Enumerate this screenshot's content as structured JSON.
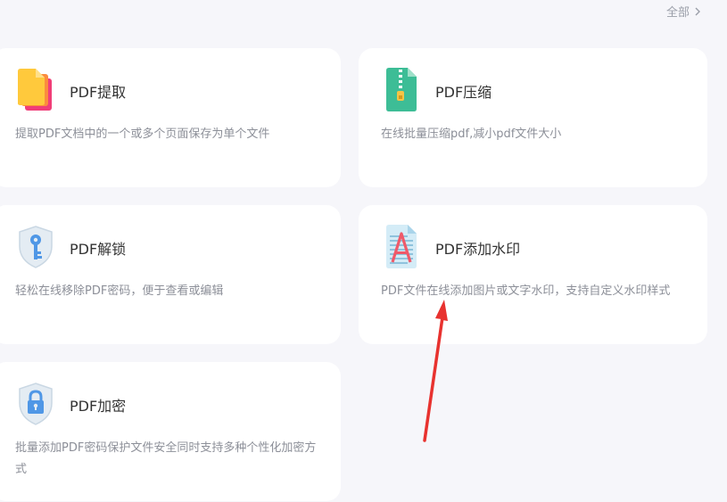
{
  "header": {
    "more_label": "全部",
    "more_icon": "chevron-right-icon"
  },
  "cards": [
    {
      "title": "PDF提取",
      "desc": "提取PDF文档中的一个或多个页面保存为单个文件",
      "icon": "pages-extract-icon"
    },
    {
      "title": "PDF压缩",
      "desc": "在线批量压缩pdf,减小pdf文件大小",
      "icon": "zip-file-icon"
    },
    {
      "title": "PDF解锁",
      "desc": "轻松在线移除PDF密码，便于查看或编辑",
      "icon": "shield-key-icon"
    },
    {
      "title": "PDF添加水印",
      "desc": "PDF文件在线添加图片或文字水印，支持自定义水印样式",
      "icon": "watermark-document-icon"
    },
    {
      "title": "PDF加密",
      "desc": "批量添加PDF密码保护文件安全同时支持多种个性化加密方式",
      "icon": "shield-lock-icon"
    }
  ],
  "annotation": {
    "type": "arrow",
    "color": "#e8322f"
  }
}
